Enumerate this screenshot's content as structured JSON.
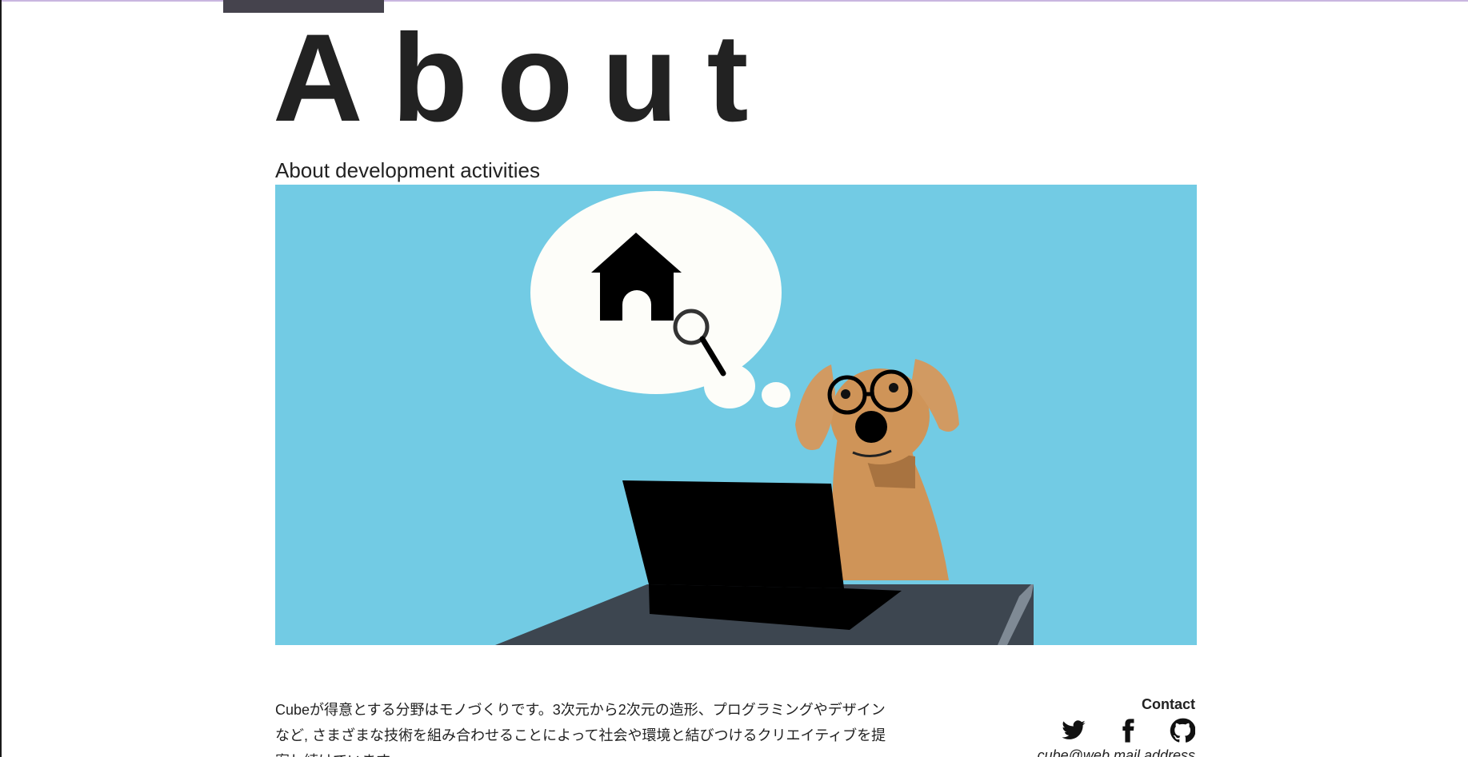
{
  "header": {
    "title": "About",
    "subtitle": "About development activities"
  },
  "hero": {
    "image": "dog-with-glasses-at-laptop-thinking-of-house-search",
    "background_color": "#72cbe4"
  },
  "body": {
    "description": "Cubeが得意とする分野はモノづくりです。3次元から2次元の造形、プログラミングやデザインなど, さまざまな技術を組み合わせることによって社会や環境と結びつけるクリエイティブを提案し続けています。"
  },
  "contact": {
    "heading": "Contact",
    "icons": [
      "twitter-icon",
      "facebook-icon",
      "github-icon"
    ],
    "email": "cube@web.mail.address"
  },
  "colors": {
    "text": "#222222",
    "accent_tab": "#45434d",
    "top_line": "#c9b6e0"
  }
}
